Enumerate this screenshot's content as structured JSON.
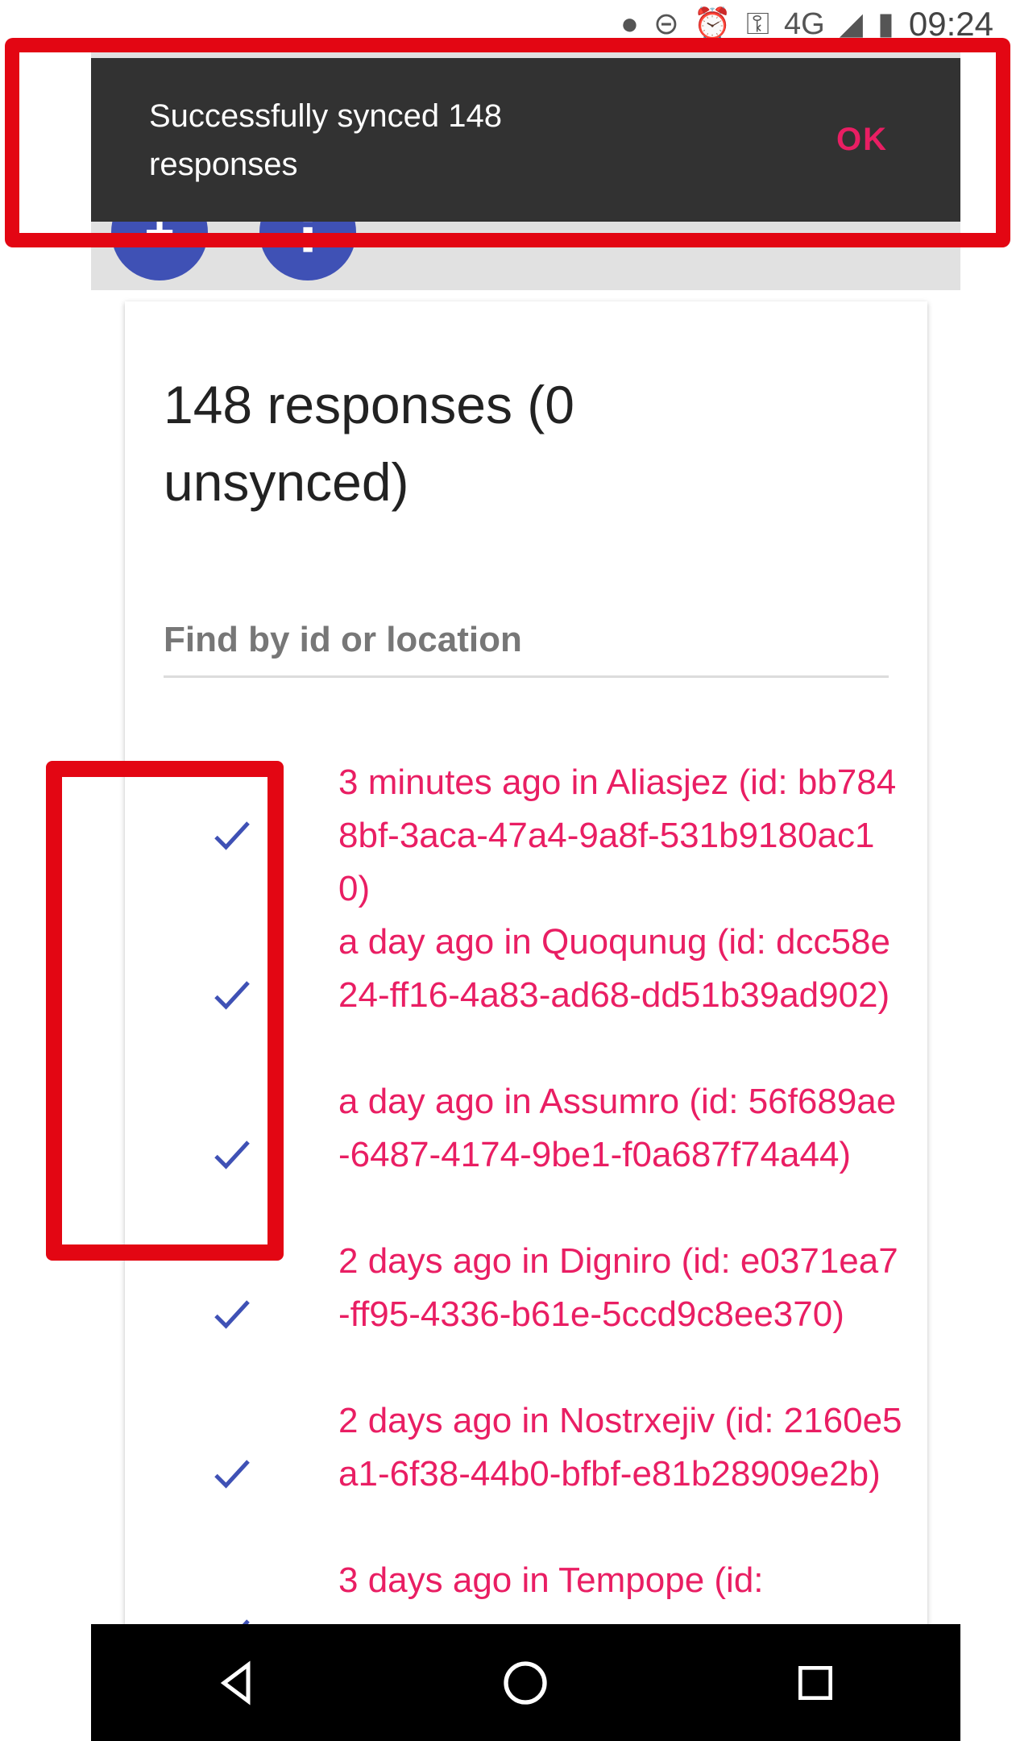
{
  "status_bar": {
    "icons": [
      "location-icon",
      "do-not-disturb-icon",
      "alarm-icon",
      "vpn-key-icon",
      "network-4g-icon",
      "signal-icon",
      "battery-icon"
    ],
    "network_label": "4G",
    "time": "09:24"
  },
  "snackbar": {
    "message": "Successfully synced 148 responses",
    "action": "OK"
  },
  "fabs": {
    "add_symbol": "+",
    "more_symbol": "⋮"
  },
  "card": {
    "title": "148 responses (0 unsynced)",
    "search_placeholder": "Find by id or location",
    "search_value": ""
  },
  "responses": [
    {
      "text": "3 minutes ago in Aliasjez (id: bb7848bf-3aca-47a4-9a8f-531b9180ac10)",
      "synced": true
    },
    {
      "text": "a day ago in Quoqunug (id: dcc58e24-ff16-4a83-ad68-dd51b39ad902)",
      "synced": true
    },
    {
      "text": "a day ago in Assumro (id: 56f689ae-6487-4174-9be1-f0a687f74a44)",
      "synced": true
    },
    {
      "text": "2 days ago in Digniro (id: e0371ea7-ff95-4336-b61e-5ccd9c8ee370)",
      "synced": true
    },
    {
      "text": "2 days ago in Nostrxejiv (id: 2160e5a1-6f38-44b0-bfbf-e81b28909e2b)",
      "synced": true
    },
    {
      "text": "3 days ago in Tempope (id:",
      "synced": true
    }
  ],
  "colors": {
    "accent": "#e91e63",
    "primary": "#3f51b5",
    "snackbar_bg": "#323232",
    "highlight": "#e30613"
  },
  "nav": {
    "back": "back-icon",
    "home": "home-icon",
    "recents": "recents-icon"
  }
}
